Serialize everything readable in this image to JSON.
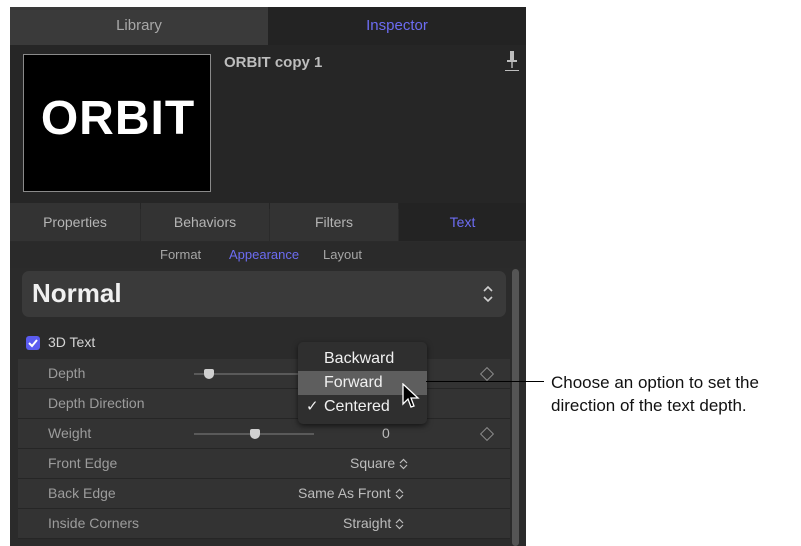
{
  "tabs": {
    "library": "Library",
    "inspector": "Inspector"
  },
  "header": {
    "preview_text": "ORBIT",
    "object_name": "ORBIT copy 1"
  },
  "sub_tabs": [
    "Properties",
    "Behaviors",
    "Filters",
    "Text"
  ],
  "sub_sub_tabs": [
    "Format",
    "Appearance",
    "Layout"
  ],
  "preset": {
    "value": "Normal"
  },
  "section": {
    "label": "3D Text",
    "checked": true
  },
  "rows": [
    {
      "label": "Depth",
      "value": ""
    },
    {
      "label": "Depth Direction",
      "value": "Centered"
    },
    {
      "label": "Weight",
      "value": "0"
    },
    {
      "label": "Front Edge",
      "value": "Square"
    },
    {
      "label": "Back Edge",
      "value": "Same As Front"
    },
    {
      "label": "Inside Corners",
      "value": "Straight"
    }
  ],
  "popup": {
    "items": [
      "Backward",
      "Forward",
      "Centered"
    ],
    "highlighted": "Forward",
    "checked": "Centered",
    "check_mark": "✓"
  },
  "callout": {
    "text": "Choose an option to set the direction of the text depth."
  },
  "colors": {
    "accent": "#6c6cf2",
    "checkbox": "#5b5cf0",
    "panel": "#2b2b2b"
  }
}
